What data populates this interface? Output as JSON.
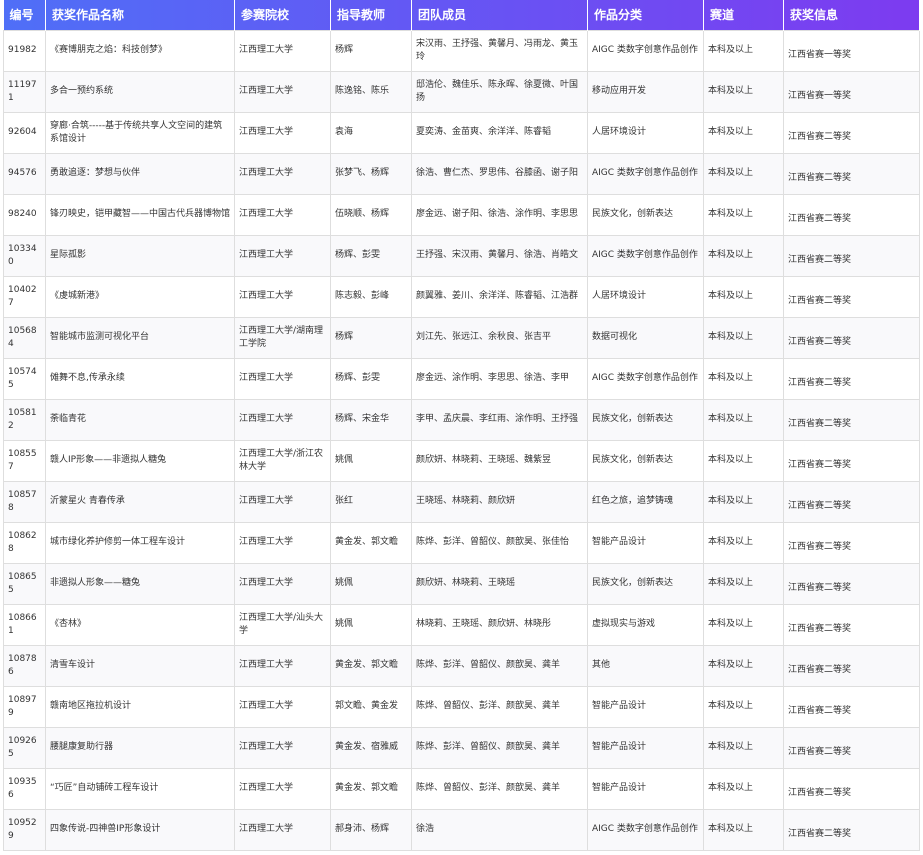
{
  "table": {
    "headers": [
      "编号",
      "获奖作品名称",
      "参赛院校",
      "指导教师",
      "团队成员",
      "作品分类",
      "赛道",
      "获奖信息"
    ],
    "rows": [
      [
        "91982",
        "《赛博朋克之焰：科技创梦》",
        "江西理工大学",
        "杨辉",
        "宋汉雨、王抒强、黄馨月、冯雨龙、黄玉玲",
        "AIGC 类数字创意作品创作",
        "本科及以上",
        "江西省赛一等奖"
      ],
      [
        "111971",
        "多合一预约系统",
        "江西理工大学",
        "陈逸铭、陈乐",
        "邸浩伦、魏佳乐、陈永晖、徐夏微、叶国扬",
        "移动应用开发",
        "本科及以上",
        "江西省赛一等奖"
      ],
      [
        "92604",
        "穿廊·合筑-----基于传统共享人文空间的建筑系馆设计",
        "江西理工大学",
        "袁海",
        "夏奕涛、金苗爽、余洋洋、陈睿韬",
        "人居环境设计",
        "本科及以上",
        "江西省赛二等奖"
      ],
      [
        "94576",
        "勇敢追逐：梦想与伙伴",
        "江西理工大学",
        "张梦飞、杨辉",
        "徐浩、曹仁杰、罗思伟、谷膝函、谢子阳",
        "AIGC 类数字创意作品创作",
        "本科及以上",
        "江西省赛二等奖"
      ],
      [
        "98240",
        "锋刃映史，铠甲藏智——中国古代兵器博物馆",
        "江西理工大学",
        "伍晓顺、杨辉",
        "廖金远、谢子阳、徐浩、涂作明、李思思",
        "民族文化，创新表达",
        "本科及以上",
        "江西省赛二等奖"
      ],
      [
        "103340",
        "星际孤影",
        "江西理工大学",
        "杨辉、彭雯",
        "王抒强、宋汉雨、黄馨月、徐浩、肖皓文",
        "AIGC 类数字创意作品创作",
        "本科及以上",
        "江西省赛二等奖"
      ],
      [
        "104027",
        "《虔城新港》",
        "江西理工大学",
        "陈志毅、彭峰",
        "颜翼雅、姜川、余洋洋、陈睿韬、江浩群",
        "人居环境设计",
        "本科及以上",
        "江西省赛二等奖"
      ],
      [
        "105684",
        "智能城市监测可视化平台",
        "江西理工大学/湖南理工学院",
        "杨辉",
        "刘江先、张远江、余秋良、张吉平",
        "数据可视化",
        "本科及以上",
        "江西省赛二等奖"
      ],
      [
        "105745",
        "傩舞不息,传承永续",
        "江西理工大学",
        "杨辉、彭雯",
        "廖金远、涂作明、李思思、徐浩、李甲",
        "AIGC 类数字创意作品创作",
        "本科及以上",
        "江西省赛二等奖"
      ],
      [
        "105812",
        "荼临青花",
        "江西理工大学",
        "杨辉、宋金华",
        "李甲、孟庆晨、李红雨、涂作明、王抒强",
        "民族文化，创新表达",
        "本科及以上",
        "江西省赛二等奖"
      ],
      [
        "108557",
        "赣人IP形象——非遗拟人糖兔",
        "江西理工大学/浙江农林大学",
        "姚佩",
        "颜欣妍、林晓莉、王晓瑶、魏紫昱",
        "民族文化，创新表达",
        "本科及以上",
        "江西省赛二等奖"
      ],
      [
        "108578",
        "沂蒙星火 青春传承",
        "江西理工大学",
        "张红",
        "王晓瑶、林晓莉、颜欣妍",
        "红色之旅，追梦铸魂",
        "本科及以上",
        "江西省赛二等奖"
      ],
      [
        "108628",
        "城市绿化养护修剪一体工程车设计",
        "江西理工大学",
        "黄金发、郭文瞻",
        "陈烨、彭洋、曾韶仪、颜歆昊、张佳怡",
        "智能产品设计",
        "本科及以上",
        "江西省赛二等奖"
      ],
      [
        "108655",
        "非遗拟人形象——糖兔",
        "江西理工大学",
        "姚佩",
        "颜欣妍、林晓莉、王晓瑶",
        "民族文化，创新表达",
        "本科及以上",
        "江西省赛二等奖"
      ],
      [
        "108661",
        "《杏林》",
        "江西理工大学/汕头大学",
        "姚佩",
        "林晓莉、王晓瑶、颜欣妍、林晓彤",
        "虚拟现实与游戏",
        "本科及以上",
        "江西省赛二等奖"
      ],
      [
        "108786",
        "清雪车设计",
        "江西理工大学",
        "黄金发、郭文瞻",
        "陈烨、彭洋、曾韶仪、颜歆昊、龚羊",
        "其他",
        "本科及以上",
        "江西省赛二等奖"
      ],
      [
        "108979",
        "赣南地区拖拉机设计",
        "江西理工大学",
        "郭文瞻、黄金发",
        "陈烨、曾韶仪、彭洋、颜歆昊、龚羊",
        "智能产品设计",
        "本科及以上",
        "江西省赛二等奖"
      ],
      [
        "109265",
        "腰腿康复助行器",
        "江西理工大学",
        "黄金发、宿雅威",
        "陈烨、彭洋、曾韶仪、颜歆昊、龚羊",
        "智能产品设计",
        "本科及以上",
        "江西省赛二等奖"
      ],
      [
        "109356",
        "“巧匠”自动铺砖工程车设计",
        "江西理工大学",
        "黄金发、郭文瞻",
        "陈烨、曾韶仪、彭洋、颜歆昊、龚羊",
        "智能产品设计",
        "本科及以上",
        "江西省赛二等奖"
      ],
      [
        "109529",
        "四象传说-四神兽IP形象设计",
        "江西理工大学",
        "郝身沛、杨辉",
        "徐浩",
        "AIGC 类数字创意作品创作",
        "本科及以上",
        "江西省赛二等奖"
      ]
    ]
  }
}
